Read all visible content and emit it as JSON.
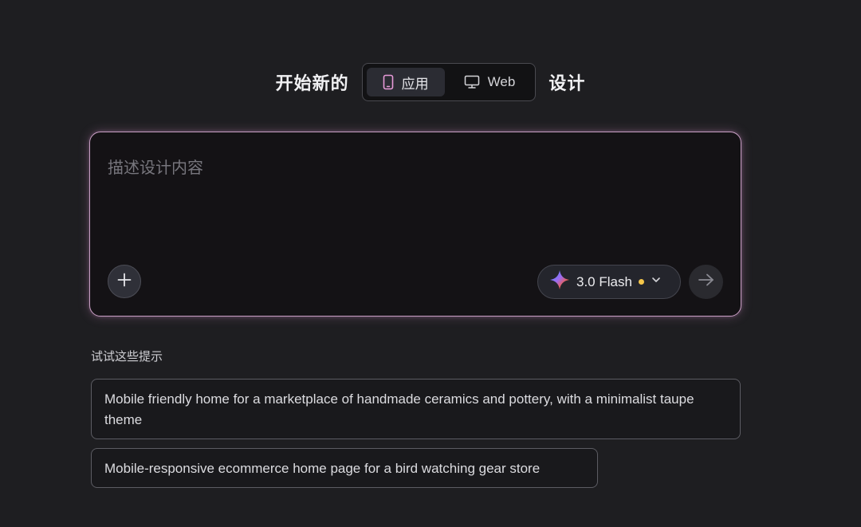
{
  "header": {
    "prefix": "开始新的",
    "suffix": "设计",
    "toggle": [
      {
        "label": "应用",
        "icon": "phone-icon",
        "selected": true
      },
      {
        "label": "Web",
        "icon": "monitor-icon",
        "selected": false
      }
    ]
  },
  "prompt": {
    "placeholder": "描述设计内容",
    "value": ""
  },
  "model": {
    "label": "3.0 Flash",
    "icon": "sparkle-icon",
    "status_color": "#f4c64a"
  },
  "suggestions": {
    "title": "试试这些提示",
    "items": [
      "Mobile friendly home for a marketplace of handmade ceramics and pottery, with a minimalist taupe theme",
      "Mobile-responsive ecommerce home page for a bird watching gear store"
    ]
  },
  "colors": {
    "background": "#1e1e21",
    "prompt_border": "#c89fc4",
    "accent_pink": "#e79ad8"
  }
}
